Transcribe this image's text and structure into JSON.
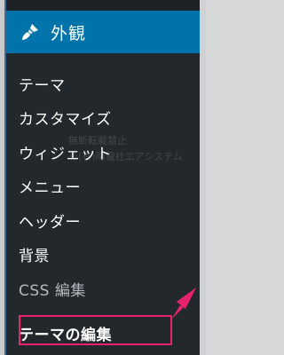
{
  "menu": {
    "title": "外観",
    "icon": "paintbrush-icon",
    "colors": {
      "sidebar_bg": "#23282d",
      "active_bg": "#0073aa",
      "highlight": "#e8226f"
    }
  },
  "submenu": {
    "items": [
      {
        "label": "テーマ"
      },
      {
        "label": "カスタマイズ"
      },
      {
        "label": "ウィジェット"
      },
      {
        "label": "メニュー"
      },
      {
        "label": "ヘッダー"
      },
      {
        "label": "背景"
      },
      {
        "label": "CSS 編集"
      },
      {
        "label": "テーマの編集"
      }
    ]
  },
  "watermark": {
    "line1": "無断転載禁止",
    "line2": "©(有)陽電社エアシステム"
  }
}
